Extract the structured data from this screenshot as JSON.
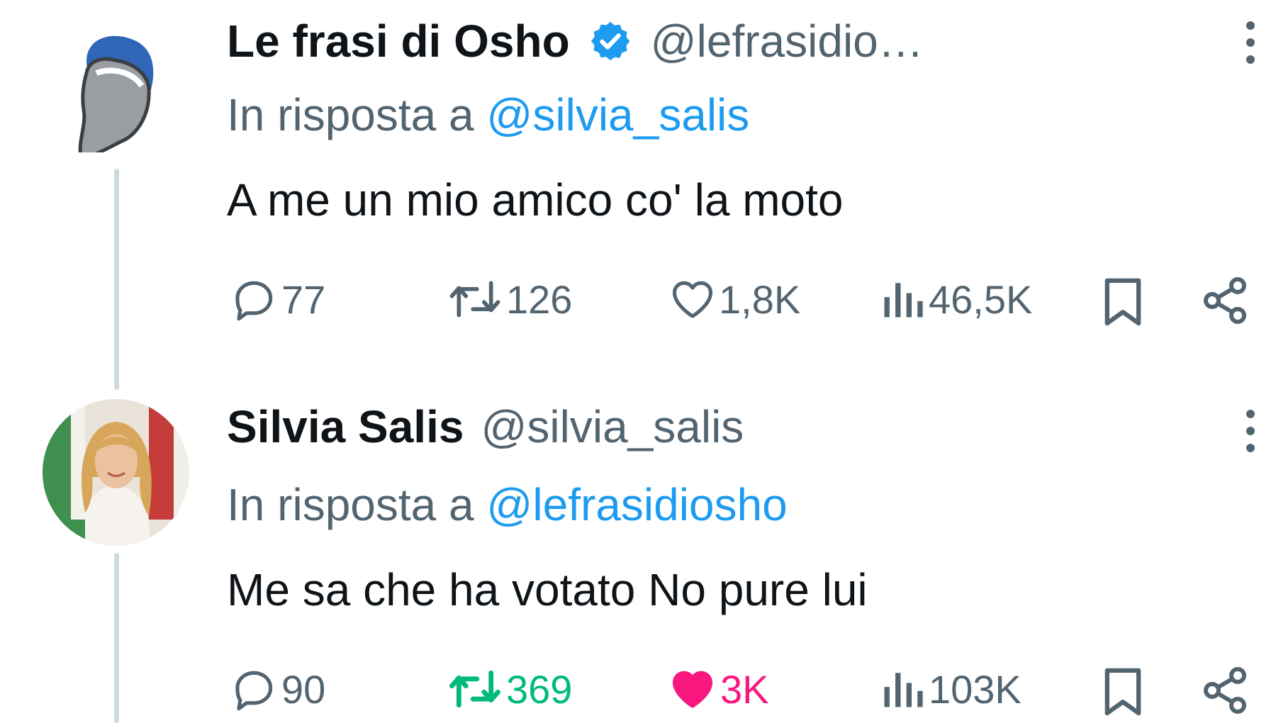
{
  "tweets": [
    {
      "author_name": "Le frasi di Osho",
      "verified": true,
      "handle": "@lefrasidio…",
      "reply_prefix": "In risposta a",
      "reply_to": "@silvia_salis",
      "text": "A me un mio amico co' la moto",
      "stats": {
        "replies": "77",
        "reposts": "126",
        "likes": "1,8K",
        "views": "46,5K"
      },
      "liked": false,
      "reposted": false
    },
    {
      "author_name": "Silvia Salis",
      "verified": false,
      "handle": "@silvia_salis",
      "reply_prefix": "In risposta a",
      "reply_to": "@lefrasidiosho",
      "text": "Me sa che ha votato No pure lui",
      "stats": {
        "replies": "90",
        "reposts": "369",
        "likes": "3K",
        "views": "103K"
      },
      "liked": true,
      "reposted": true
    }
  ],
  "icons": {
    "reply": "speech-bubble-icon",
    "repost": "repost-arrows-icon",
    "like": "heart-icon",
    "views": "bar-chart-icon",
    "bookmark": "bookmark-icon",
    "share": "share-nodes-icon",
    "more": "vertical-dots-icon",
    "verified": "verified-badge-icon"
  },
  "colors": {
    "text": "#0f1419",
    "secondary": "#536471",
    "mention": "#1d9bf0",
    "verified": "#1d9bf0",
    "repost_active": "#00ba7c",
    "like_active": "#f91880",
    "thread_line": "#cfd9de"
  }
}
